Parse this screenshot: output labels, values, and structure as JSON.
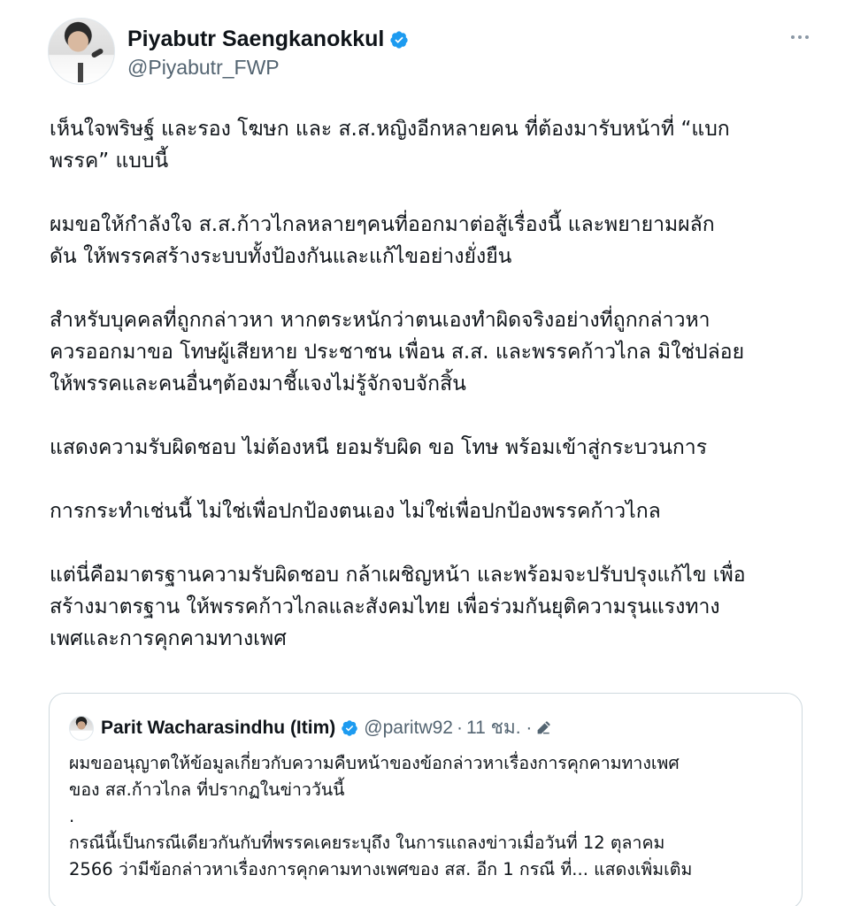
{
  "author": {
    "display_name": "Piyabutr Saengkanokkul",
    "handle": "@Piyabutr_FWP"
  },
  "tweet": {
    "paragraphs": [
      "เห็นใจพริษฐ์ และรอง โฆษก และ ส.ส.หญิงอีกหลายคน ที่ต้องมารับหน้าที่ “แบก\nพรรค” แบบนี้",
      "ผมขอให้กำลังใจ ส.ส.ก้าวไกลหลายๆคนที่ออกมาต่อสู้เรื่องนี้ และพยายามผลัก\nดัน ให้พรรคสร้างระบบทั้งป้องกันและแก้ไขอย่างยั่งยืน",
      "สำหรับบุคคลที่ถูกกล่าวหา หากตระหนักว่าตนเองทำผิดจริงอย่างที่ถูกกล่าวหา\nควรออกมาขอ โทษผู้เสียหาย ประชาชน เพื่อน ส.ส. และพรรคก้าวไกล มิใช่ปล่อย\nให้พรรคและคนอื่นๆต้องมาชี้แจงไม่รู้จักจบจักสิ้น",
      "แสดงความรับผิดชอบ ไม่ต้องหนี ยอมรับผิด ขอ โทษ พร้อมเข้าสู่กระบวนการ",
      "การกระทำเช่นนี้ ไม่ใช่เพื่อปกป้องตนเอง ไม่ใช่เพื่อปกป้องพรรคก้าวไกล",
      "แต่นี่คือมาตรฐานความรับผิดชอบ กล้าเผชิญหน้า และพร้อมจะปรับปรุงแก้ไข เพื่อ\nสร้างมาตรฐาน ให้พรรคก้าวไกลและสังคมไทย เพื่อร่วมกันยุติความรุนแรงทาง\nเพศและการคุกคามทางเพศ"
    ]
  },
  "quoted_tweet": {
    "display_name": "Parit Wacharasindhu (Itim)",
    "handle": "@paritw92",
    "separator": "·",
    "time": "11 ชม. ·",
    "lines": [
      "ผมขออนุญาตให้ข้อมูลเกี่ยวกับความคืบหน้าของข้อกล่าวหาเรื่องการคุกคามทางเพศ",
      "ของ สส.ก้าวไกล ที่ปรากฏในข่าววันนี้",
      ".",
      "กรณีนี้เป็นกรณีเดียวกันกับที่พรรคเคยระบุถึง ในการแถลงข่าวเมื่อวันที่ 12 ตุลาคม",
      "2566 ว่ามีข้อกล่าวหาเรื่องการคุกคามทางเพศของ สส. อีก 1 กรณี ที่..."
    ],
    "show_more": "แสดงเพิ่มเติม"
  },
  "colors": {
    "verified": "#1d9bf0",
    "secondary_text": "#536471",
    "border": "#cfd9de"
  },
  "icons": {
    "verified": "verified-badge-icon",
    "more": "more-horizontal-icon",
    "edit": "pencil-edit-icon"
  }
}
